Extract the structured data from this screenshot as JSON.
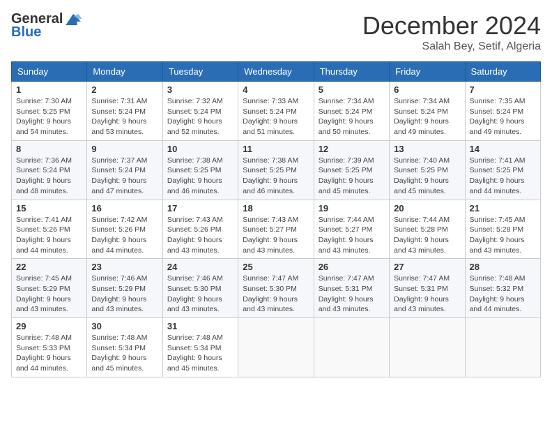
{
  "header": {
    "logo_general": "General",
    "logo_blue": "Blue",
    "month_title": "December 2024",
    "location": "Salah Bey, Setif, Algeria"
  },
  "days_of_week": [
    "Sunday",
    "Monday",
    "Tuesday",
    "Wednesday",
    "Thursday",
    "Friday",
    "Saturday"
  ],
  "weeks": [
    [
      {
        "day": "1",
        "sunrise": "7:30 AM",
        "sunset": "5:25 PM",
        "daylight": "9 hours and 54 minutes."
      },
      {
        "day": "2",
        "sunrise": "7:31 AM",
        "sunset": "5:24 PM",
        "daylight": "9 hours and 53 minutes."
      },
      {
        "day": "3",
        "sunrise": "7:32 AM",
        "sunset": "5:24 PM",
        "daylight": "9 hours and 52 minutes."
      },
      {
        "day": "4",
        "sunrise": "7:33 AM",
        "sunset": "5:24 PM",
        "daylight": "9 hours and 51 minutes."
      },
      {
        "day": "5",
        "sunrise": "7:34 AM",
        "sunset": "5:24 PM",
        "daylight": "9 hours and 50 minutes."
      },
      {
        "day": "6",
        "sunrise": "7:34 AM",
        "sunset": "5:24 PM",
        "daylight": "9 hours and 49 minutes."
      },
      {
        "day": "7",
        "sunrise": "7:35 AM",
        "sunset": "5:24 PM",
        "daylight": "9 hours and 49 minutes."
      }
    ],
    [
      {
        "day": "8",
        "sunrise": "7:36 AM",
        "sunset": "5:24 PM",
        "daylight": "9 hours and 48 minutes."
      },
      {
        "day": "9",
        "sunrise": "7:37 AM",
        "sunset": "5:24 PM",
        "daylight": "9 hours and 47 minutes."
      },
      {
        "day": "10",
        "sunrise": "7:38 AM",
        "sunset": "5:25 PM",
        "daylight": "9 hours and 46 minutes."
      },
      {
        "day": "11",
        "sunrise": "7:38 AM",
        "sunset": "5:25 PM",
        "daylight": "9 hours and 46 minutes."
      },
      {
        "day": "12",
        "sunrise": "7:39 AM",
        "sunset": "5:25 PM",
        "daylight": "9 hours and 45 minutes."
      },
      {
        "day": "13",
        "sunrise": "7:40 AM",
        "sunset": "5:25 PM",
        "daylight": "9 hours and 45 minutes."
      },
      {
        "day": "14",
        "sunrise": "7:41 AM",
        "sunset": "5:25 PM",
        "daylight": "9 hours and 44 minutes."
      }
    ],
    [
      {
        "day": "15",
        "sunrise": "7:41 AM",
        "sunset": "5:26 PM",
        "daylight": "9 hours and 44 minutes."
      },
      {
        "day": "16",
        "sunrise": "7:42 AM",
        "sunset": "5:26 PM",
        "daylight": "9 hours and 44 minutes."
      },
      {
        "day": "17",
        "sunrise": "7:43 AM",
        "sunset": "5:26 PM",
        "daylight": "9 hours and 43 minutes."
      },
      {
        "day": "18",
        "sunrise": "7:43 AM",
        "sunset": "5:27 PM",
        "daylight": "9 hours and 43 minutes."
      },
      {
        "day": "19",
        "sunrise": "7:44 AM",
        "sunset": "5:27 PM",
        "daylight": "9 hours and 43 minutes."
      },
      {
        "day": "20",
        "sunrise": "7:44 AM",
        "sunset": "5:28 PM",
        "daylight": "9 hours and 43 minutes."
      },
      {
        "day": "21",
        "sunrise": "7:45 AM",
        "sunset": "5:28 PM",
        "daylight": "9 hours and 43 minutes."
      }
    ],
    [
      {
        "day": "22",
        "sunrise": "7:45 AM",
        "sunset": "5:29 PM",
        "daylight": "9 hours and 43 minutes."
      },
      {
        "day": "23",
        "sunrise": "7:46 AM",
        "sunset": "5:29 PM",
        "daylight": "9 hours and 43 minutes."
      },
      {
        "day": "24",
        "sunrise": "7:46 AM",
        "sunset": "5:30 PM",
        "daylight": "9 hours and 43 minutes."
      },
      {
        "day": "25",
        "sunrise": "7:47 AM",
        "sunset": "5:30 PM",
        "daylight": "9 hours and 43 minutes."
      },
      {
        "day": "26",
        "sunrise": "7:47 AM",
        "sunset": "5:31 PM",
        "daylight": "9 hours and 43 minutes."
      },
      {
        "day": "27",
        "sunrise": "7:47 AM",
        "sunset": "5:31 PM",
        "daylight": "9 hours and 43 minutes."
      },
      {
        "day": "28",
        "sunrise": "7:48 AM",
        "sunset": "5:32 PM",
        "daylight": "9 hours and 44 minutes."
      }
    ],
    [
      {
        "day": "29",
        "sunrise": "7:48 AM",
        "sunset": "5:33 PM",
        "daylight": "9 hours and 44 minutes."
      },
      {
        "day": "30",
        "sunrise": "7:48 AM",
        "sunset": "5:34 PM",
        "daylight": "9 hours and 45 minutes."
      },
      {
        "day": "31",
        "sunrise": "7:48 AM",
        "sunset": "5:34 PM",
        "daylight": "9 hours and 45 minutes."
      },
      null,
      null,
      null,
      null
    ]
  ],
  "labels": {
    "sunrise": "Sunrise:",
    "sunset": "Sunset:",
    "daylight": "Daylight:"
  }
}
